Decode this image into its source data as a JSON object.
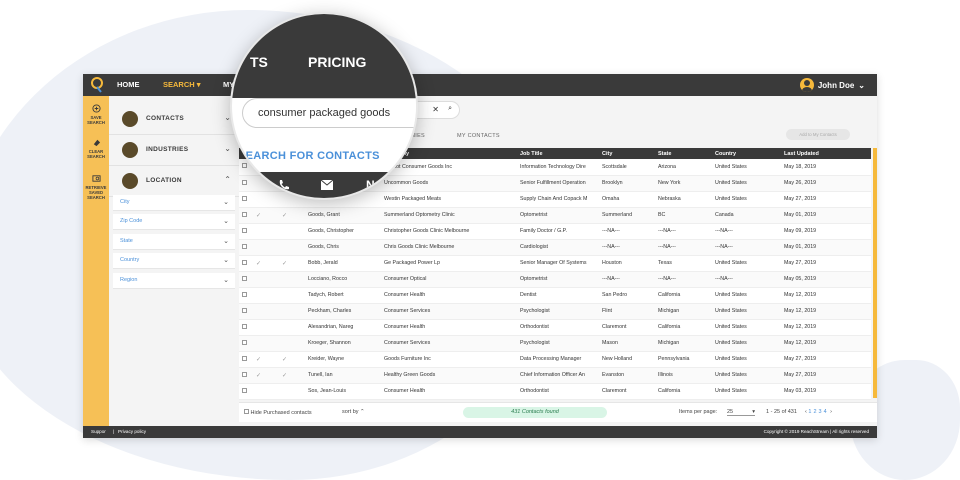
{
  "nav": {
    "home": "HOME",
    "search": "SEARCH",
    "my_c": "MY C"
  },
  "user": {
    "name": "John Doe"
  },
  "leftbar": {
    "save": "SAVE SEARCH",
    "clear": "CLEAR SEARCH",
    "retrieve": "RETRIEVE SAVED SEARCH"
  },
  "filters": {
    "sections": [
      "CONTACTS",
      "INDUSTRIES",
      "LOCATION"
    ],
    "location_items": [
      "City",
      "Zip Code",
      "State",
      "Country",
      "Region"
    ]
  },
  "tabs": {
    "companies": "ANIES",
    "my_contacts": "MY CONTACTS"
  },
  "add_button": "Add to My Contacts",
  "table": {
    "headers": [
      "",
      "",
      "",
      "",
      "Company",
      "Job Title",
      "City",
      "State",
      "Country",
      "Last Updated"
    ],
    "rows": [
      [
        "",
        "",
        "",
        "",
        "Kenkot Consumer Goods Inc",
        "Information Technology Dire",
        "Scottsdale",
        "Arizona",
        "United States",
        "May 18, 2019"
      ],
      [
        "",
        "",
        "",
        "",
        "Uncommon Goods",
        "Senior Fulfillment Operation",
        "Brooklyn",
        "New York",
        "United States",
        "May 26, 2019"
      ],
      [
        "",
        "",
        "",
        "",
        "Westin Packaged Meats",
        "Supply Chain And Copack M",
        "Omaha",
        "Nebraska",
        "United States",
        "May 27, 2019"
      ],
      [
        "",
        "✓",
        "✓",
        "Goods, Grant",
        "Summerland Optometry Clinic",
        "Optometrist",
        "Summerland",
        "BC",
        "Canada",
        "May 01, 2019"
      ],
      [
        "",
        "",
        "",
        "Goods, Christopher",
        "Christopher Goods Clinic Melbourne",
        "Family Doctor / G.P.",
        "---NA---",
        "---NA---",
        "---NA---",
        "May 09, 2019"
      ],
      [
        "",
        "",
        "",
        "Goods, Chris",
        "Chris Goods Clinic Melbourne",
        "Cardiologist",
        "---NA---",
        "---NA---",
        "---NA---",
        "May 01, 2019"
      ],
      [
        "",
        "✓",
        "✓",
        "Bobb, Jerald",
        "Ge Packaged Power Lp",
        "Senior Manager Of Systems",
        "Houston",
        "Texas",
        "United States",
        "May 27, 2019"
      ],
      [
        "",
        "",
        "",
        "Locciano, Rocco",
        "Consumer Optical",
        "Optometrist",
        "---NA---",
        "---NA---",
        "---NA---",
        "May 05, 2019"
      ],
      [
        "",
        "",
        "",
        "Tadych, Robert",
        "Consumer Health",
        "Dentist",
        "San Pedro",
        "California",
        "United States",
        "May 12, 2019"
      ],
      [
        "",
        "",
        "",
        "Peckham, Charles",
        "Consumer Services",
        "Psychologist",
        "Flint",
        "Michigan",
        "United States",
        "May 12, 2019"
      ],
      [
        "",
        "",
        "",
        "Alexandrian, Nareg",
        "Consumer Health",
        "Orthodontist",
        "Claremont",
        "California",
        "United States",
        "May 12, 2019"
      ],
      [
        "",
        "",
        "",
        "Kroeger, Shannon",
        "Consumer Services",
        "Psychologist",
        "Mason",
        "Michigan",
        "United States",
        "May 12, 2019"
      ],
      [
        "",
        "✓",
        "✓",
        "Kreider, Wayne",
        "Goods Furniture Inc",
        "Data Processing Manager",
        "New Holland",
        "Pennsylvania",
        "United States",
        "May 27, 2019"
      ],
      [
        "",
        "✓",
        "✓",
        "Tunell, Ian",
        "Healthy Green Goods",
        "Chief Information Officer An",
        "Evanston",
        "Illinois",
        "United States",
        "May 27, 2019"
      ],
      [
        "",
        "",
        "",
        "Sos, Jean-Louis",
        "Consumer Health",
        "Orthodontist",
        "Claremont",
        "California",
        "United States",
        "May 03, 2019"
      ]
    ]
  },
  "footer": {
    "hide_purchased": "Hide Purchased contacts",
    "sort_by": "sort by",
    "found": "431 Contacts found",
    "items_per_page_label": "Items per page:",
    "items_per_page": "25",
    "range": "1 - 25 of 431",
    "pages": [
      "1",
      "2",
      "3",
      "4"
    ]
  },
  "bottom": {
    "support": "Suppor",
    "privacy": "Privacy policy",
    "copyright": "Copyright © 2019 ReachStream  |  All rights reserved"
  },
  "magnifier": {
    "nav_left": "TS",
    "nav_pricing": "PRICING",
    "search_value": "consumer packaged goods",
    "link": "SEARCH FOR CONTACTS",
    "name_col": "Name"
  },
  "colors": {
    "accent": "#f6b93b",
    "dark": "#3a3a3a",
    "link": "#4a90d9"
  }
}
